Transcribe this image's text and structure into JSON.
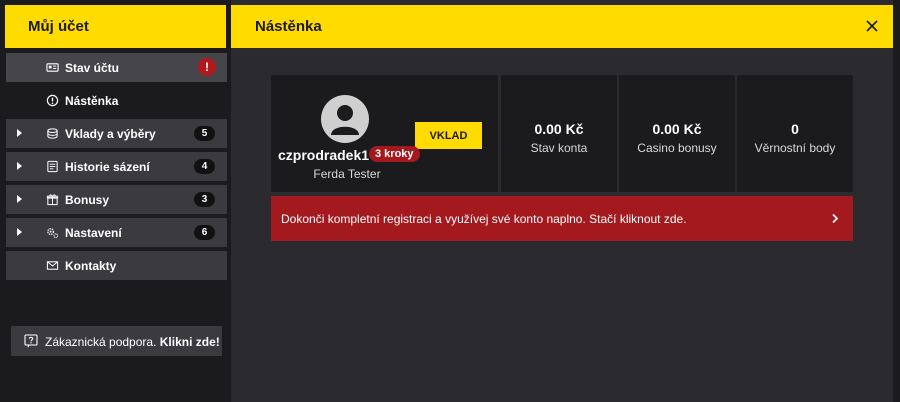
{
  "sidebar": {
    "title": "Můj účet",
    "items": [
      {
        "label": "Stav účtu",
        "icon": "id-card-icon",
        "badge": "!"
      },
      {
        "label": "Nástěnka",
        "icon": "info-circle-icon"
      },
      {
        "label": "Vklady a výběry",
        "icon": "coins-icon",
        "badge": "5"
      },
      {
        "label": "Historie sázení",
        "icon": "ticket-icon",
        "badge": "4"
      },
      {
        "label": "Bonusy",
        "icon": "gift-icon",
        "badge": "3"
      },
      {
        "label": "Nastavení",
        "icon": "gears-icon",
        "badge": "6"
      },
      {
        "label": "Kontakty",
        "icon": "envelope-icon"
      }
    ],
    "support": {
      "text": "Zákaznická podpora.",
      "link": "Klikni zde!"
    }
  },
  "main": {
    "title": "Nástěnka",
    "profile": {
      "username": "czprodradek1",
      "steps": "3 kroky",
      "full_name": "Ferda Tester",
      "deposit_label": "VKLAD"
    },
    "stats": [
      {
        "value": "0.00 Kč",
        "label": "Stav konta"
      },
      {
        "value": "0.00 Kč",
        "label": "Casino bonusy"
      },
      {
        "value": "0",
        "label": "Věrnostní body"
      }
    ],
    "banner": "Dokonči kompletní registraci a využívej své konto naplno. Stačí kliknout zde."
  },
  "colors": {
    "accent": "#ffdb00",
    "alert": "#a3191e",
    "panel": "#1b1a1d",
    "menu_item": "#3b3a3e"
  }
}
